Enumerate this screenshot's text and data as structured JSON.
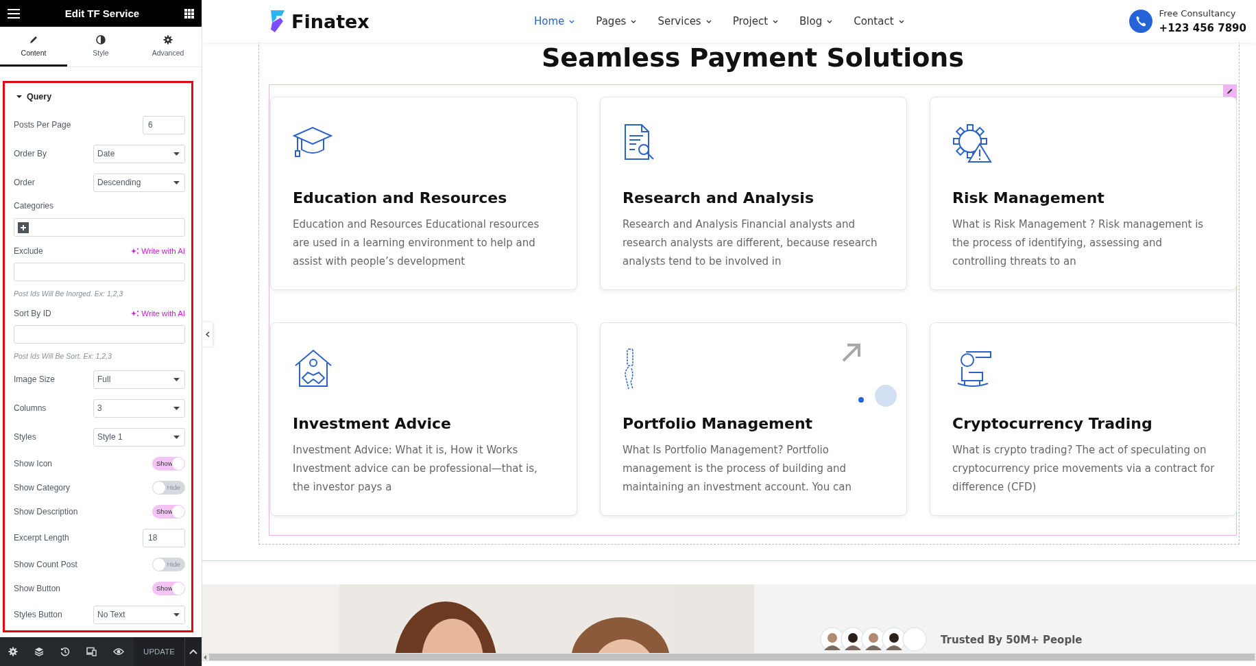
{
  "panel": {
    "title": "Edit TF Service",
    "tabs": [
      {
        "label": "Content",
        "selected": true
      },
      {
        "label": "Style",
        "selected": false
      },
      {
        "label": "Advanced",
        "selected": false
      }
    ],
    "section": {
      "title": "Query",
      "expanded": true
    },
    "controls": [
      {
        "kind": "number",
        "label": "Posts Per Page",
        "value": "6"
      },
      {
        "kind": "select",
        "label": "Order By",
        "value": "Date"
      },
      {
        "kind": "select",
        "label": "Order",
        "value": "Descending"
      },
      {
        "kind": "gallery",
        "label": "Categories"
      },
      {
        "kind": "text",
        "label": "Exclude",
        "ai_link": "Write with AI"
      },
      {
        "kind": "hint",
        "text": "Post Ids Will Be Inorged. Ex: 1,2,3"
      },
      {
        "kind": "text",
        "label": "Sort By ID",
        "ai_link": "Write with AI"
      },
      {
        "kind": "hint",
        "text": "Post Ids Will Be Sort. Ex: 1,2,3"
      },
      {
        "kind": "select",
        "label": "Image Size",
        "value": "Full"
      },
      {
        "kind": "select",
        "label": "Columns",
        "value": "3"
      },
      {
        "kind": "select",
        "label": "Styles",
        "value": "Style 1"
      },
      {
        "kind": "toggle",
        "label": "Show Icon",
        "on": true,
        "text": "Show"
      },
      {
        "kind": "toggle",
        "label": "Show Category",
        "on": false,
        "text": "Hide"
      },
      {
        "kind": "toggle",
        "label": "Show Description",
        "on": true,
        "text": "Show"
      },
      {
        "kind": "number",
        "label": "Excerpt Length",
        "value": "18"
      },
      {
        "kind": "toggle",
        "label": "Show Count Post",
        "on": false,
        "text": "Hide"
      },
      {
        "kind": "toggle",
        "label": "Show Button",
        "on": true,
        "text": "Show"
      },
      {
        "kind": "select",
        "label": "Styles Button",
        "value": "No Text"
      }
    ],
    "footer": {
      "update": "UPDATE"
    }
  },
  "site": {
    "logo": "Finatex",
    "nav": [
      {
        "label": "Home",
        "selected": true
      },
      {
        "label": "Pages",
        "selected": false
      },
      {
        "label": "Services",
        "selected": false
      },
      {
        "label": "Project",
        "selected": false
      },
      {
        "label": "Blog",
        "selected": false
      },
      {
        "label": "Contact",
        "selected": false
      }
    ],
    "contact": {
      "label": "Free Consultancy",
      "phone": "+123 456 7890"
    },
    "heading": "Seamless Payment Solutions",
    "cards": [
      {
        "title": "Education and Resources",
        "description": "Education and Resources Educational resources are used in a learning environment to help and assist with people’s development"
      },
      {
        "title": "Research and Analysis",
        "description": "Research and Analysis Financial analysts and research analysts are different, because research analysts tend to be involved in"
      },
      {
        "title": "Risk Management",
        "description": "What is Risk Management ? Risk management is the process of identifying, assessing and controlling threats to an"
      },
      {
        "title": "Investment Advice",
        "description": "Investment Advice: What it is, How it Works Investment advice can be professional—that is, the investor pays a"
      },
      {
        "title": "Portfolio Management",
        "description": "What Is Portfolio Management? Portfolio management is the process of building and maintaining an investment account. You can",
        "hovered": true
      },
      {
        "title": "Cryptocurrency Trading",
        "description": "What is crypto trading? The act of speculating on cryptocurrency price movements via a contract for difference (CFD)"
      }
    ],
    "hero": {
      "trusted": "Trusted By 50M+ People"
    }
  }
}
